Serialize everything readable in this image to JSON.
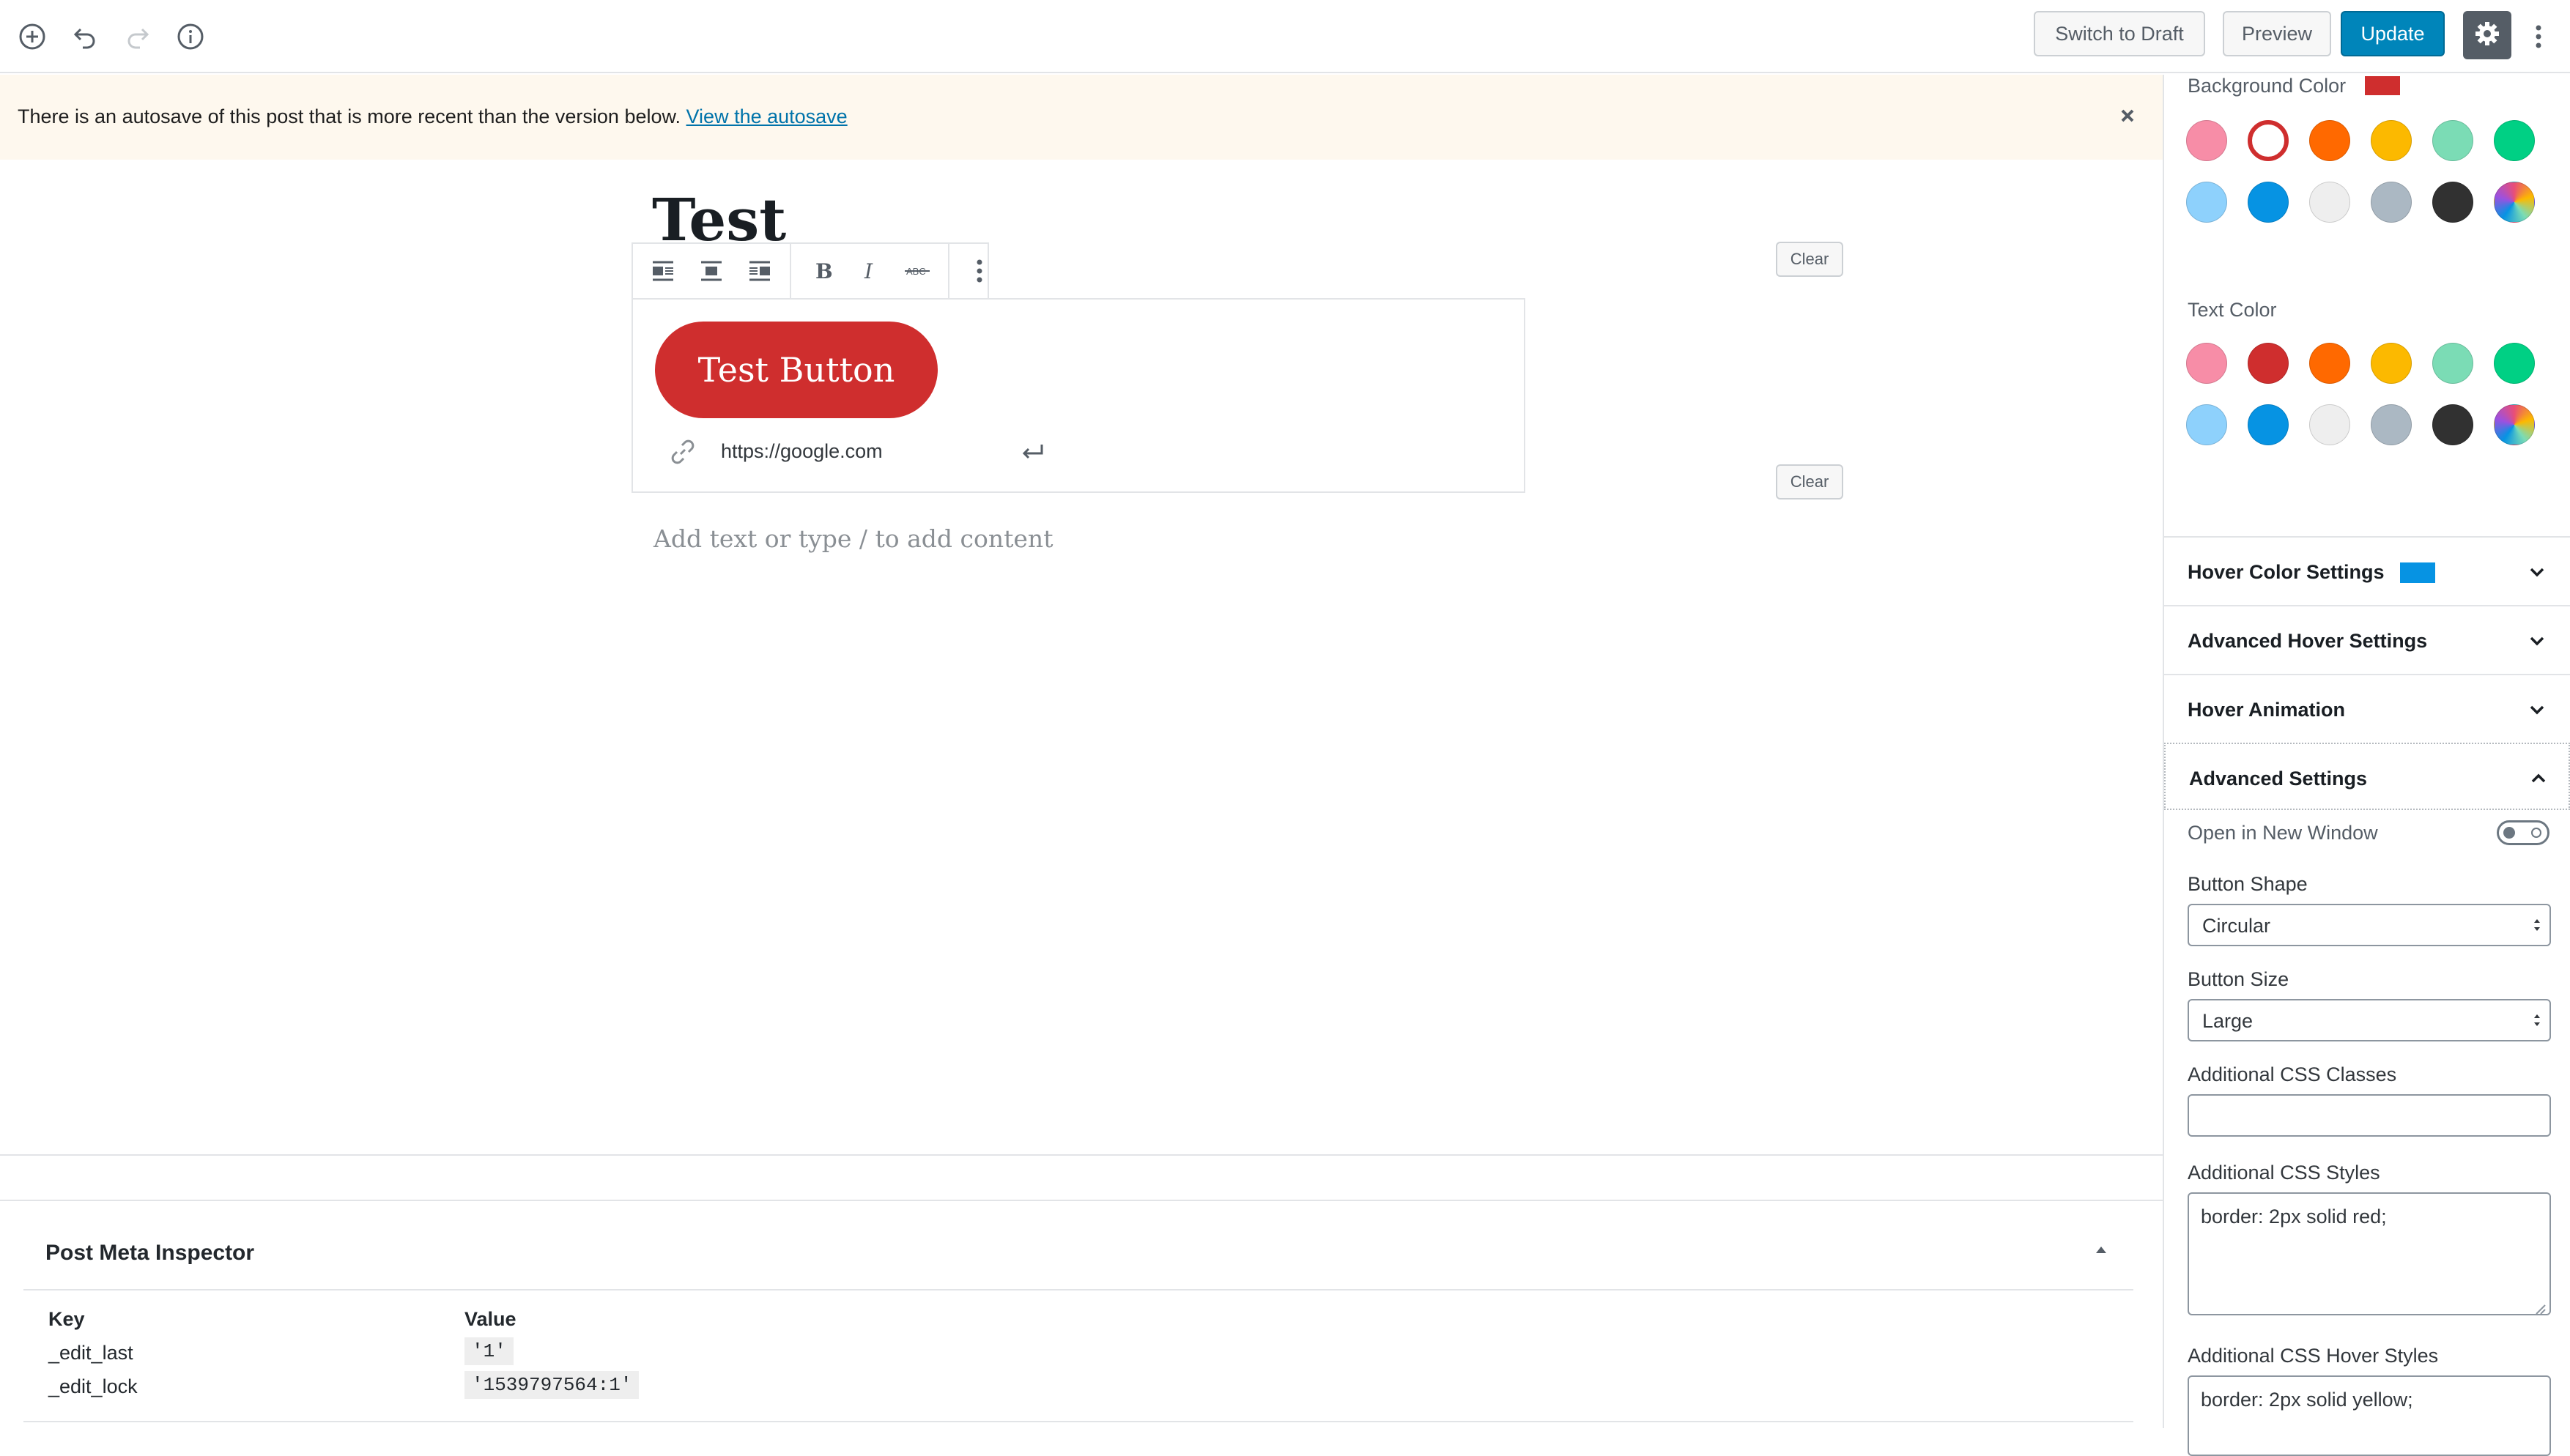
{
  "topbar": {
    "switch_draft_label": "Switch to Draft",
    "preview_label": "Preview",
    "update_label": "Update",
    "accent_color": "#0085ba"
  },
  "notice": {
    "text": "There is an autosave of this post that is more recent than the version below.",
    "link_text": "View the autosave"
  },
  "editor": {
    "post_title": "Test",
    "button_text": "Test Button",
    "button_color": "#cf2e2e",
    "url_value": "https://google.com",
    "placeholder": "Add text or type / to add content"
  },
  "meta_inspector": {
    "title": "Post Meta Inspector",
    "col_key": "Key",
    "col_value": "Value",
    "rows": [
      {
        "key": "_edit_last",
        "value": "'1'"
      },
      {
        "key": "_edit_lock",
        "value": "'1539797564:1'"
      }
    ]
  },
  "sidebar": {
    "background_color": {
      "label": "Background Color",
      "current": "#cf2e2e",
      "clear_label": "Clear"
    },
    "text_color": {
      "label": "Text Color",
      "clear_label": "Clear"
    },
    "palette": [
      "#f78da7",
      "#cf2e2e",
      "#ff6900",
      "#fcb900",
      "#7bdcb5",
      "#00d084",
      "#8ed1fc",
      "#0693e3",
      "#eeeeee",
      "#abb8c3",
      "#313131",
      "gradient"
    ],
    "panels": {
      "hover_color": "Hover Color Settings",
      "hover_color_indicator": "#0693e3",
      "advanced_hover": "Advanced Hover Settings",
      "hover_animation": "Hover Animation",
      "advanced_settings": "Advanced Settings"
    },
    "advanced": {
      "new_window_label": "Open in New Window",
      "shape_label": "Button Shape",
      "shape_value": "Circular",
      "size_label": "Button Size",
      "size_value": "Large",
      "css_classes_label": "Additional CSS Classes",
      "css_classes_value": "",
      "css_styles_label": "Additional CSS Styles",
      "css_styles_value": "border: 2px solid red;",
      "css_hover_label": "Additional CSS Hover Styles",
      "css_hover_value": "border: 2px solid yellow;"
    }
  }
}
